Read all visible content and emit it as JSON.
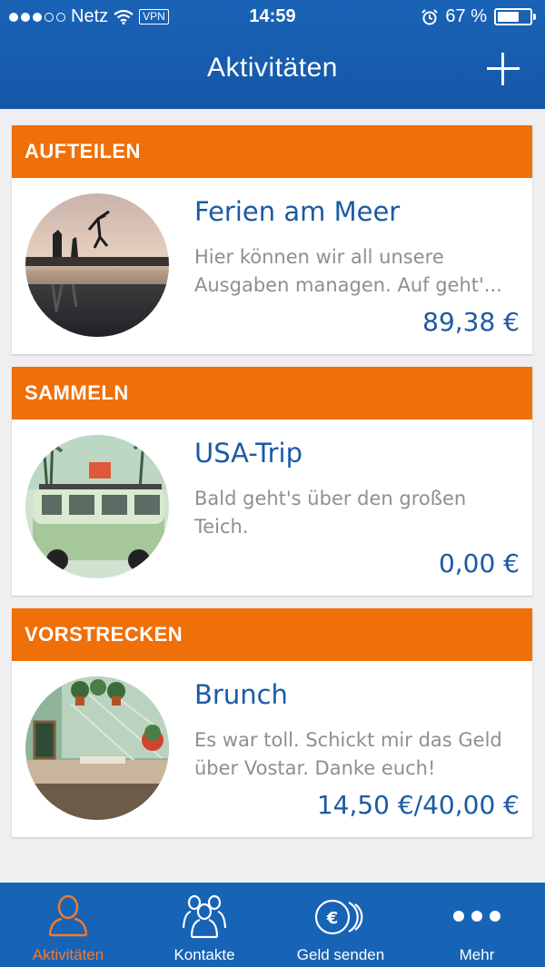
{
  "status_bar": {
    "carrier": "Netz",
    "vpn": "VPN",
    "time": "14:59",
    "battery": "67 %",
    "battery_level": 0.67
  },
  "header": {
    "title": "Aktivitäten",
    "add_icon": "plus-icon"
  },
  "cards": [
    {
      "category": "AUFTEILEN",
      "title": "Ferien am Meer",
      "description": "Hier können wir all unsere Ausgaben managen. Auf geht'...",
      "amount": "89,38 €"
    },
    {
      "category": "SAMMELN",
      "title": "USA-Trip",
      "description": "Bald geht's über den großen Teich.",
      "amount": "0,00 €"
    },
    {
      "category": "VORSTRECKEN",
      "title": "Brunch",
      "description": "Es war toll. Schickt mir das Geld über Vostar. Danke euch!",
      "amount": "14,50 €/40,00 €"
    }
  ],
  "tabs": [
    {
      "label": "Aktivitäten",
      "icon": "person-icon",
      "active": true
    },
    {
      "label": "Kontakte",
      "icon": "contacts-icon",
      "active": false
    },
    {
      "label": "Geld senden",
      "icon": "euro-coins-icon",
      "active": false
    },
    {
      "label": "Mehr",
      "icon": "more-dots-icon",
      "active": false
    }
  ],
  "colors": {
    "header": "#1763b5",
    "accent": "#ef6f09",
    "link": "#1c5aa3",
    "active_tab": "#f07a2d"
  }
}
